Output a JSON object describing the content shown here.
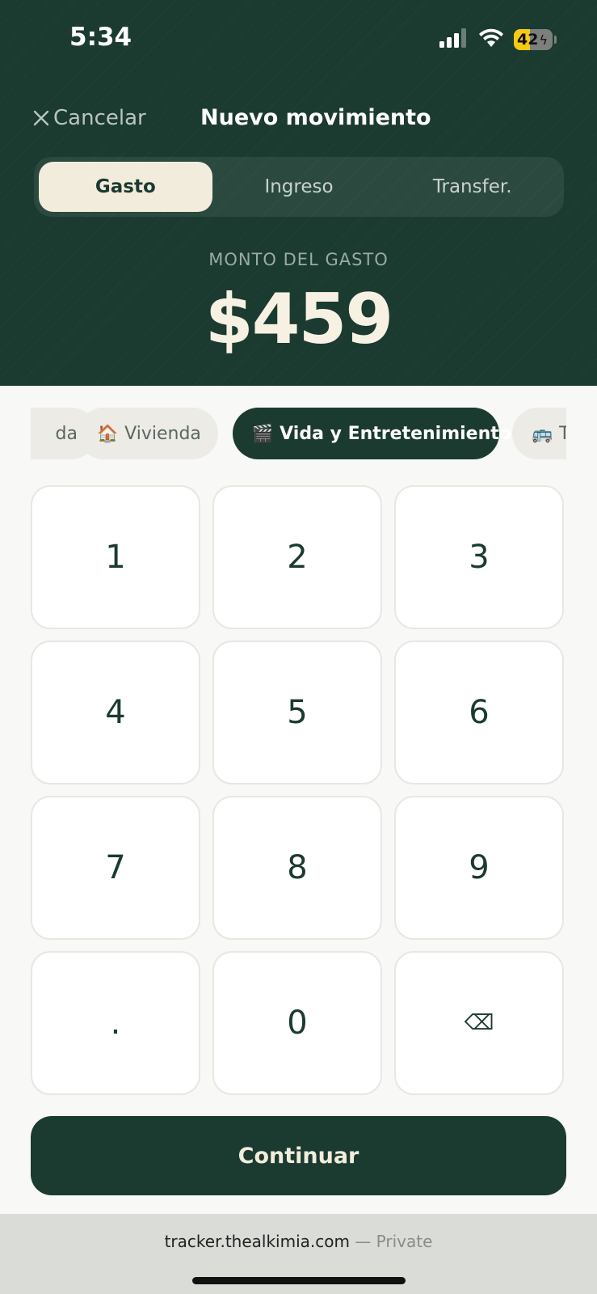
{
  "status_bar": {
    "time": "5:34",
    "battery_level": "42",
    "battery_percent": 42
  },
  "nav": {
    "cancel_label": "Cancelar",
    "title": "Nuevo movimiento"
  },
  "type_tabs": [
    {
      "label": "Gasto",
      "active": true
    },
    {
      "label": "Ingreso",
      "active": false
    },
    {
      "label": "Transfer.",
      "active": false
    }
  ],
  "amount": {
    "label": "MONTO DEL GASTO",
    "value": "$459"
  },
  "categories": [
    {
      "emoji": "",
      "label": "da",
      "active": false
    },
    {
      "emoji": "🏠",
      "label": "Vivienda",
      "active": false
    },
    {
      "emoji": "🎬",
      "label": "Vida y Entretenimiento",
      "active": true
    },
    {
      "emoji": "🚌",
      "label": "T",
      "active": false
    }
  ],
  "keypad": {
    "keys": [
      "1",
      "2",
      "3",
      "4",
      "5",
      "6",
      "7",
      "8",
      "9",
      ".",
      "0",
      "⌫"
    ]
  },
  "continue_label": "Continuar",
  "browser": {
    "domain": "tracker.thealkimia.com",
    "privacy": "— Private"
  },
  "colors": {
    "brand_dark": "#1b3a30",
    "cream": "#f2ecdc",
    "battery": "#f6c913"
  },
  "icons": [
    "signal-icon",
    "wifi-icon",
    "battery-icon",
    "close-icon",
    "house-emoji",
    "clapper-emoji",
    "bus-emoji",
    "backspace-icon"
  ]
}
